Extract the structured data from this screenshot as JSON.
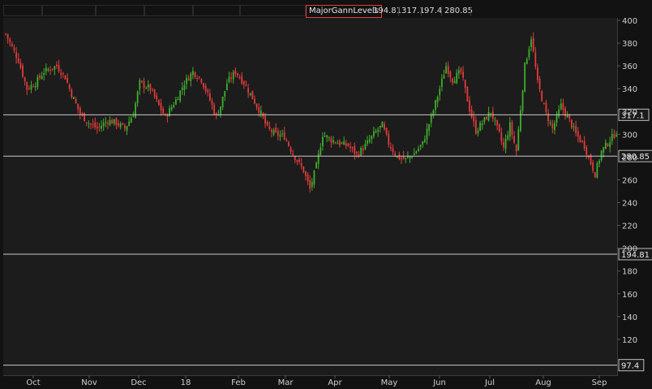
{
  "header": {
    "study_name": "MajorGannLevels",
    "values": [
      "194.81",
      "317.1",
      "97.4",
      "280.85"
    ]
  },
  "colors": {
    "up": "#3fae2c",
    "down": "#e23b3b",
    "level_line": "#c8c8c8",
    "background": "#1c1c1c",
    "axis_text": "#cfcfcf"
  },
  "chart_data": {
    "type": "candlestick",
    "xlabel": "",
    "ylabel": "",
    "y_range": [
      0,
      400
    ],
    "y_ticks": [
      "120",
      "140",
      "160",
      "180",
      "200",
      "220",
      "240",
      "260",
      "280",
      "300",
      "320",
      "340",
      "360",
      "380",
      "400"
    ],
    "x_ticks": [
      "Oct",
      "Nov",
      "Dec",
      "18",
      "Feb",
      "Mar",
      "Apr",
      "May",
      "Jun",
      "Jul",
      "Aug",
      "Sep"
    ],
    "levels": [
      {
        "label": "317.1",
        "value": 317.1
      },
      {
        "label": "280.85",
        "value": 280.85
      },
      {
        "label": "194.81",
        "value": 194.81
      },
      {
        "label": "97.4",
        "value": 97.4
      }
    ],
    "close_path": [
      [
        0,
        388
      ],
      [
        6,
        365
      ],
      [
        10,
        340
      ],
      [
        14,
        345
      ],
      [
        18,
        355
      ],
      [
        24,
        360
      ],
      [
        28,
        350
      ],
      [
        31,
        335
      ],
      [
        35,
        318
      ],
      [
        39,
        310
      ],
      [
        43,
        305
      ],
      [
        48,
        312
      ],
      [
        52,
        310
      ],
      [
        56,
        305
      ],
      [
        60,
        318
      ],
      [
        63,
        345
      ],
      [
        68,
        340
      ],
      [
        72,
        325
      ],
      [
        75,
        315
      ],
      [
        80,
        330
      ],
      [
        84,
        345
      ],
      [
        88,
        355
      ],
      [
        92,
        348
      ],
      [
        96,
        330
      ],
      [
        99,
        315
      ],
      [
        101,
        325
      ],
      [
        104,
        345
      ],
      [
        108,
        355
      ],
      [
        112,
        345
      ],
      [
        116,
        332
      ],
      [
        120,
        318
      ],
      [
        123,
        305
      ],
      [
        127,
        300
      ],
      [
        131,
        298
      ],
      [
        135,
        283
      ],
      [
        140,
        268
      ],
      [
        143,
        252
      ],
      [
        146,
        272
      ],
      [
        149,
        300
      ],
      [
        153,
        295
      ],
      [
        157,
        292
      ],
      [
        161,
        290
      ],
      [
        165,
        282
      ],
      [
        169,
        290
      ],
      [
        173,
        300
      ],
      [
        177,
        308
      ],
      [
        180,
        292
      ],
      [
        184,
        280
      ],
      [
        188,
        278
      ],
      [
        192,
        283
      ],
      [
        196,
        292
      ],
      [
        200,
        315
      ],
      [
        204,
        340
      ],
      [
        207,
        360
      ],
      [
        210,
        348
      ],
      [
        214,
        355
      ],
      [
        218,
        322
      ],
      [
        221,
        303
      ],
      [
        224,
        310
      ],
      [
        228,
        320
      ],
      [
        232,
        300
      ],
      [
        234,
        288
      ],
      [
        237,
        308
      ],
      [
        240,
        285
      ],
      [
        244,
        360
      ],
      [
        247,
        385
      ],
      [
        250,
        345
      ],
      [
        254,
        318
      ],
      [
        257,
        305
      ],
      [
        261,
        325
      ],
      [
        265,
        312
      ],
      [
        268,
        300
      ],
      [
        272,
        290
      ],
      [
        274,
        280
      ],
      [
        277,
        265
      ],
      [
        280,
        285
      ],
      [
        284,
        295
      ],
      [
        287,
        302
      ]
    ]
  }
}
